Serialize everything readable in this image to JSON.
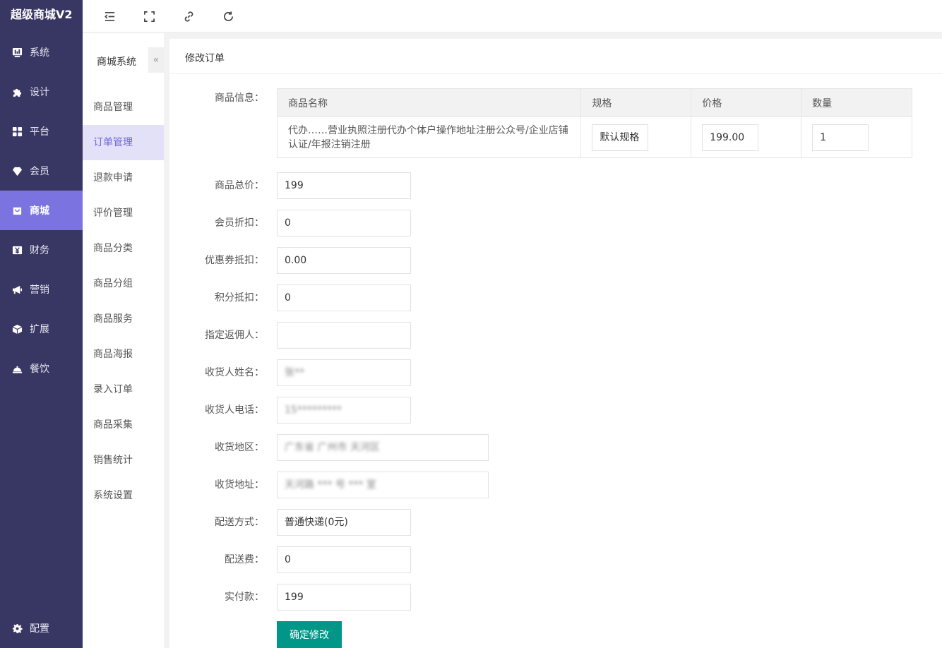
{
  "app": {
    "title": "超级商城V2"
  },
  "sidebar": {
    "items": [
      {
        "label": "系统",
        "icon": "dashboard-icon"
      },
      {
        "label": "设计",
        "icon": "puzzle-icon"
      },
      {
        "label": "平台",
        "icon": "grid-icon"
      },
      {
        "label": "会员",
        "icon": "diamond-icon"
      },
      {
        "label": "商城",
        "icon": "shop-icon",
        "active": true
      },
      {
        "label": "财务",
        "icon": "yen-icon"
      },
      {
        "label": "营销",
        "icon": "megaphone-icon"
      },
      {
        "label": "扩展",
        "icon": "cube-icon"
      },
      {
        "label": "餐饮",
        "icon": "cloche-icon"
      }
    ],
    "bottom": {
      "label": "配置",
      "icon": "gear-icon"
    }
  },
  "toolbar": {
    "icons": [
      "menu-fold-icon",
      "fullscreen-icon",
      "link-icon",
      "refresh-icon"
    ]
  },
  "subnav": {
    "title": "商城系统",
    "collapse_glyph": "«",
    "items": [
      {
        "label": "商品管理"
      },
      {
        "label": "订单管理",
        "active": true
      },
      {
        "label": "退款申请"
      },
      {
        "label": "评价管理"
      },
      {
        "label": "商品分类"
      },
      {
        "label": "商品分组"
      },
      {
        "label": "商品服务"
      },
      {
        "label": "商品海报"
      },
      {
        "label": "录入订单"
      },
      {
        "label": "商品采集"
      },
      {
        "label": "销售统计"
      },
      {
        "label": "系统设置"
      }
    ]
  },
  "main": {
    "title": "修改订单",
    "product_label": "商品信息：",
    "table": {
      "headers": [
        "商品名称",
        "规格",
        "价格",
        "数量"
      ],
      "row": {
        "name": "代办……营业执照注册代办个体户操作地址注册公众号/企业店铺认证/年报注销注册",
        "spec": "默认规格",
        "price": "199.00",
        "qty": "1"
      }
    },
    "fields": [
      {
        "label": "商品总价：",
        "value": "199"
      },
      {
        "label": "会员折扣：",
        "value": "0"
      },
      {
        "label": "优惠券抵扣：",
        "value": "0.00"
      },
      {
        "label": "积分抵扣：",
        "value": "0"
      },
      {
        "label": "指定返佣人：",
        "value": ""
      },
      {
        "label": "收货人姓名：",
        "value": "张**",
        "blurred": true
      },
      {
        "label": "收货人电话：",
        "value": "15*********",
        "blurred": true
      },
      {
        "label": "收货地区：",
        "value": "广东省 广州市 天河区",
        "blurred": true,
        "wide": true
      },
      {
        "label": "收货地址：",
        "value": "天河路 *** 号 *** 室",
        "blurred": true,
        "wide": true
      },
      {
        "label": "配送方式：",
        "value": "普通快递(0元)"
      },
      {
        "label": "配送费：",
        "value": "0"
      },
      {
        "label": "实付款：",
        "value": "199"
      }
    ],
    "submit_label": "确定修改"
  },
  "colors": {
    "sidebar_bg": "#383764",
    "sidebar_active": "#7b74e0",
    "subnav_active_bg": "#e3e1f8",
    "subnav_active_text": "#6f67d9",
    "submit_bg": "#009688"
  }
}
